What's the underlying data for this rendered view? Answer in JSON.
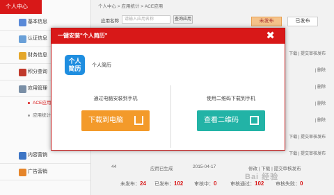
{
  "sidebar": {
    "title": "个人中心",
    "items": [
      {
        "label": "基本信息",
        "color": "#5a8ad8"
      },
      {
        "label": "认证信息",
        "color": "#6aa0d8"
      },
      {
        "label": "财务信息",
        "color": "#e4a72b"
      },
      {
        "label": "积分查询",
        "color": "#c0392b"
      },
      {
        "label": "应用管理",
        "color": "#7a8fa6"
      }
    ],
    "subs": [
      "ACE应用",
      "应用统计"
    ],
    "bottom": [
      {
        "label": "内容营销",
        "color": "#3d75c5"
      },
      {
        "label": "广告营销",
        "color": "#e5852a"
      }
    ]
  },
  "main": {
    "breadcrumb": "个人中心 > 应用统计 > ACE应用",
    "search_label": "应用名称",
    "search_placeholder": "请输入应用名称",
    "search_button": "查询应用",
    "tab_a": "未发布",
    "tab_b": "已发布",
    "row_actions": [
      "下载 | 提交审核发布",
      "| 删除",
      "| 删除",
      "| 删除",
      "| 删除",
      "下载 | 提交审核发布",
      "下载 | 提交审核发布"
    ],
    "last_row": {
      "id": "44",
      "type": "应用已生成",
      "date": "2015-04-17",
      "status": "修改 | 下载 | 提交审核发布"
    },
    "footer": {
      "l1": "未发布：",
      "v1": "24",
      "l2": "已发布：",
      "v2": "102",
      "l3": "审核中：",
      "v3": "0",
      "l4": "审核通过：",
      "v4": "102",
      "l5": "审核失败：",
      "v5": "0"
    },
    "watermark": "Bai 经验"
  },
  "modal": {
    "title": "一键安装\"个人简历\"",
    "app_icon_text": "个人\n简历",
    "app_name": "个人简历",
    "left_label": "通过电脑安装到手机",
    "left_button": "下载到电脑",
    "right_label": "使用二维码下载到手机",
    "right_button": "查看二维码",
    "close": "✖"
  }
}
